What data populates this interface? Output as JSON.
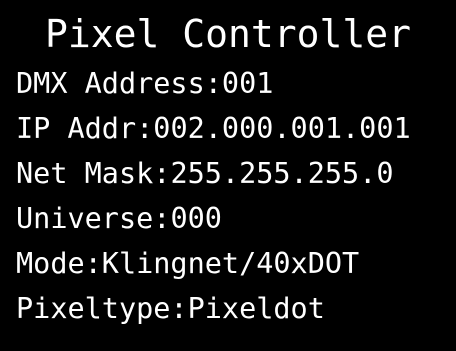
{
  "screen": {
    "title": "Pixel Controller",
    "background": "#000000",
    "text_color": "#ffffff",
    "rows": [
      {
        "label": "DMX Address:",
        "value": "001"
      },
      {
        "label": "IP Addr:",
        "value": "002.000.001.001"
      },
      {
        "label": "Net Mask:",
        "value": "255.255.255.0"
      },
      {
        "label": "Universe:",
        "value": "000"
      },
      {
        "label": "Mode:",
        "value": "Klingnet/40xDOT"
      },
      {
        "label": "Pixeltype:",
        "value": "Pixeldot"
      }
    ]
  }
}
